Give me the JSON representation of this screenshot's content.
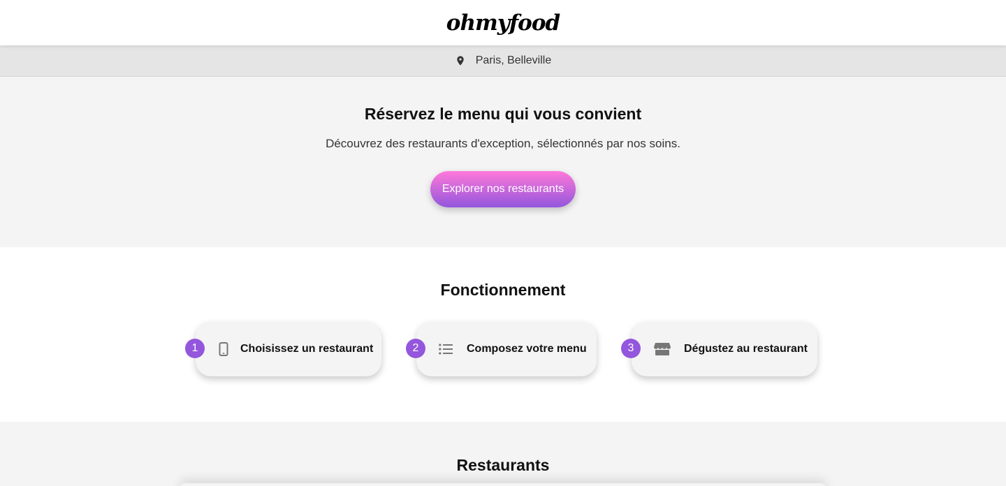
{
  "header": {
    "logo": "ohmyfood"
  },
  "location": {
    "icon": "map-pin-icon",
    "text": "Paris, Belleville"
  },
  "hero": {
    "title": "Réservez le menu qui vous convient",
    "subtitle": "Découvrez des restaurants d'exception, sélectionnés par nos soins.",
    "cta_label": "Explorer nos restaurants"
  },
  "how": {
    "title": "Fonctionnement",
    "steps": [
      {
        "number": "1",
        "icon": "smartphone-icon",
        "label": "Choisissez un restaurant"
      },
      {
        "number": "2",
        "icon": "list-icon",
        "label": "Composez votre menu"
      },
      {
        "number": "3",
        "icon": "store-icon",
        "label": "Dégustez au restaurant"
      }
    ]
  },
  "restaurants": {
    "title": "Restaurants"
  },
  "colors": {
    "accent": "#9356dc",
    "gradient_start": "#ff79da",
    "gradient_end": "#9356dc",
    "section_bg": "#f4f4f4",
    "location_bg": "#e5e5e5"
  }
}
